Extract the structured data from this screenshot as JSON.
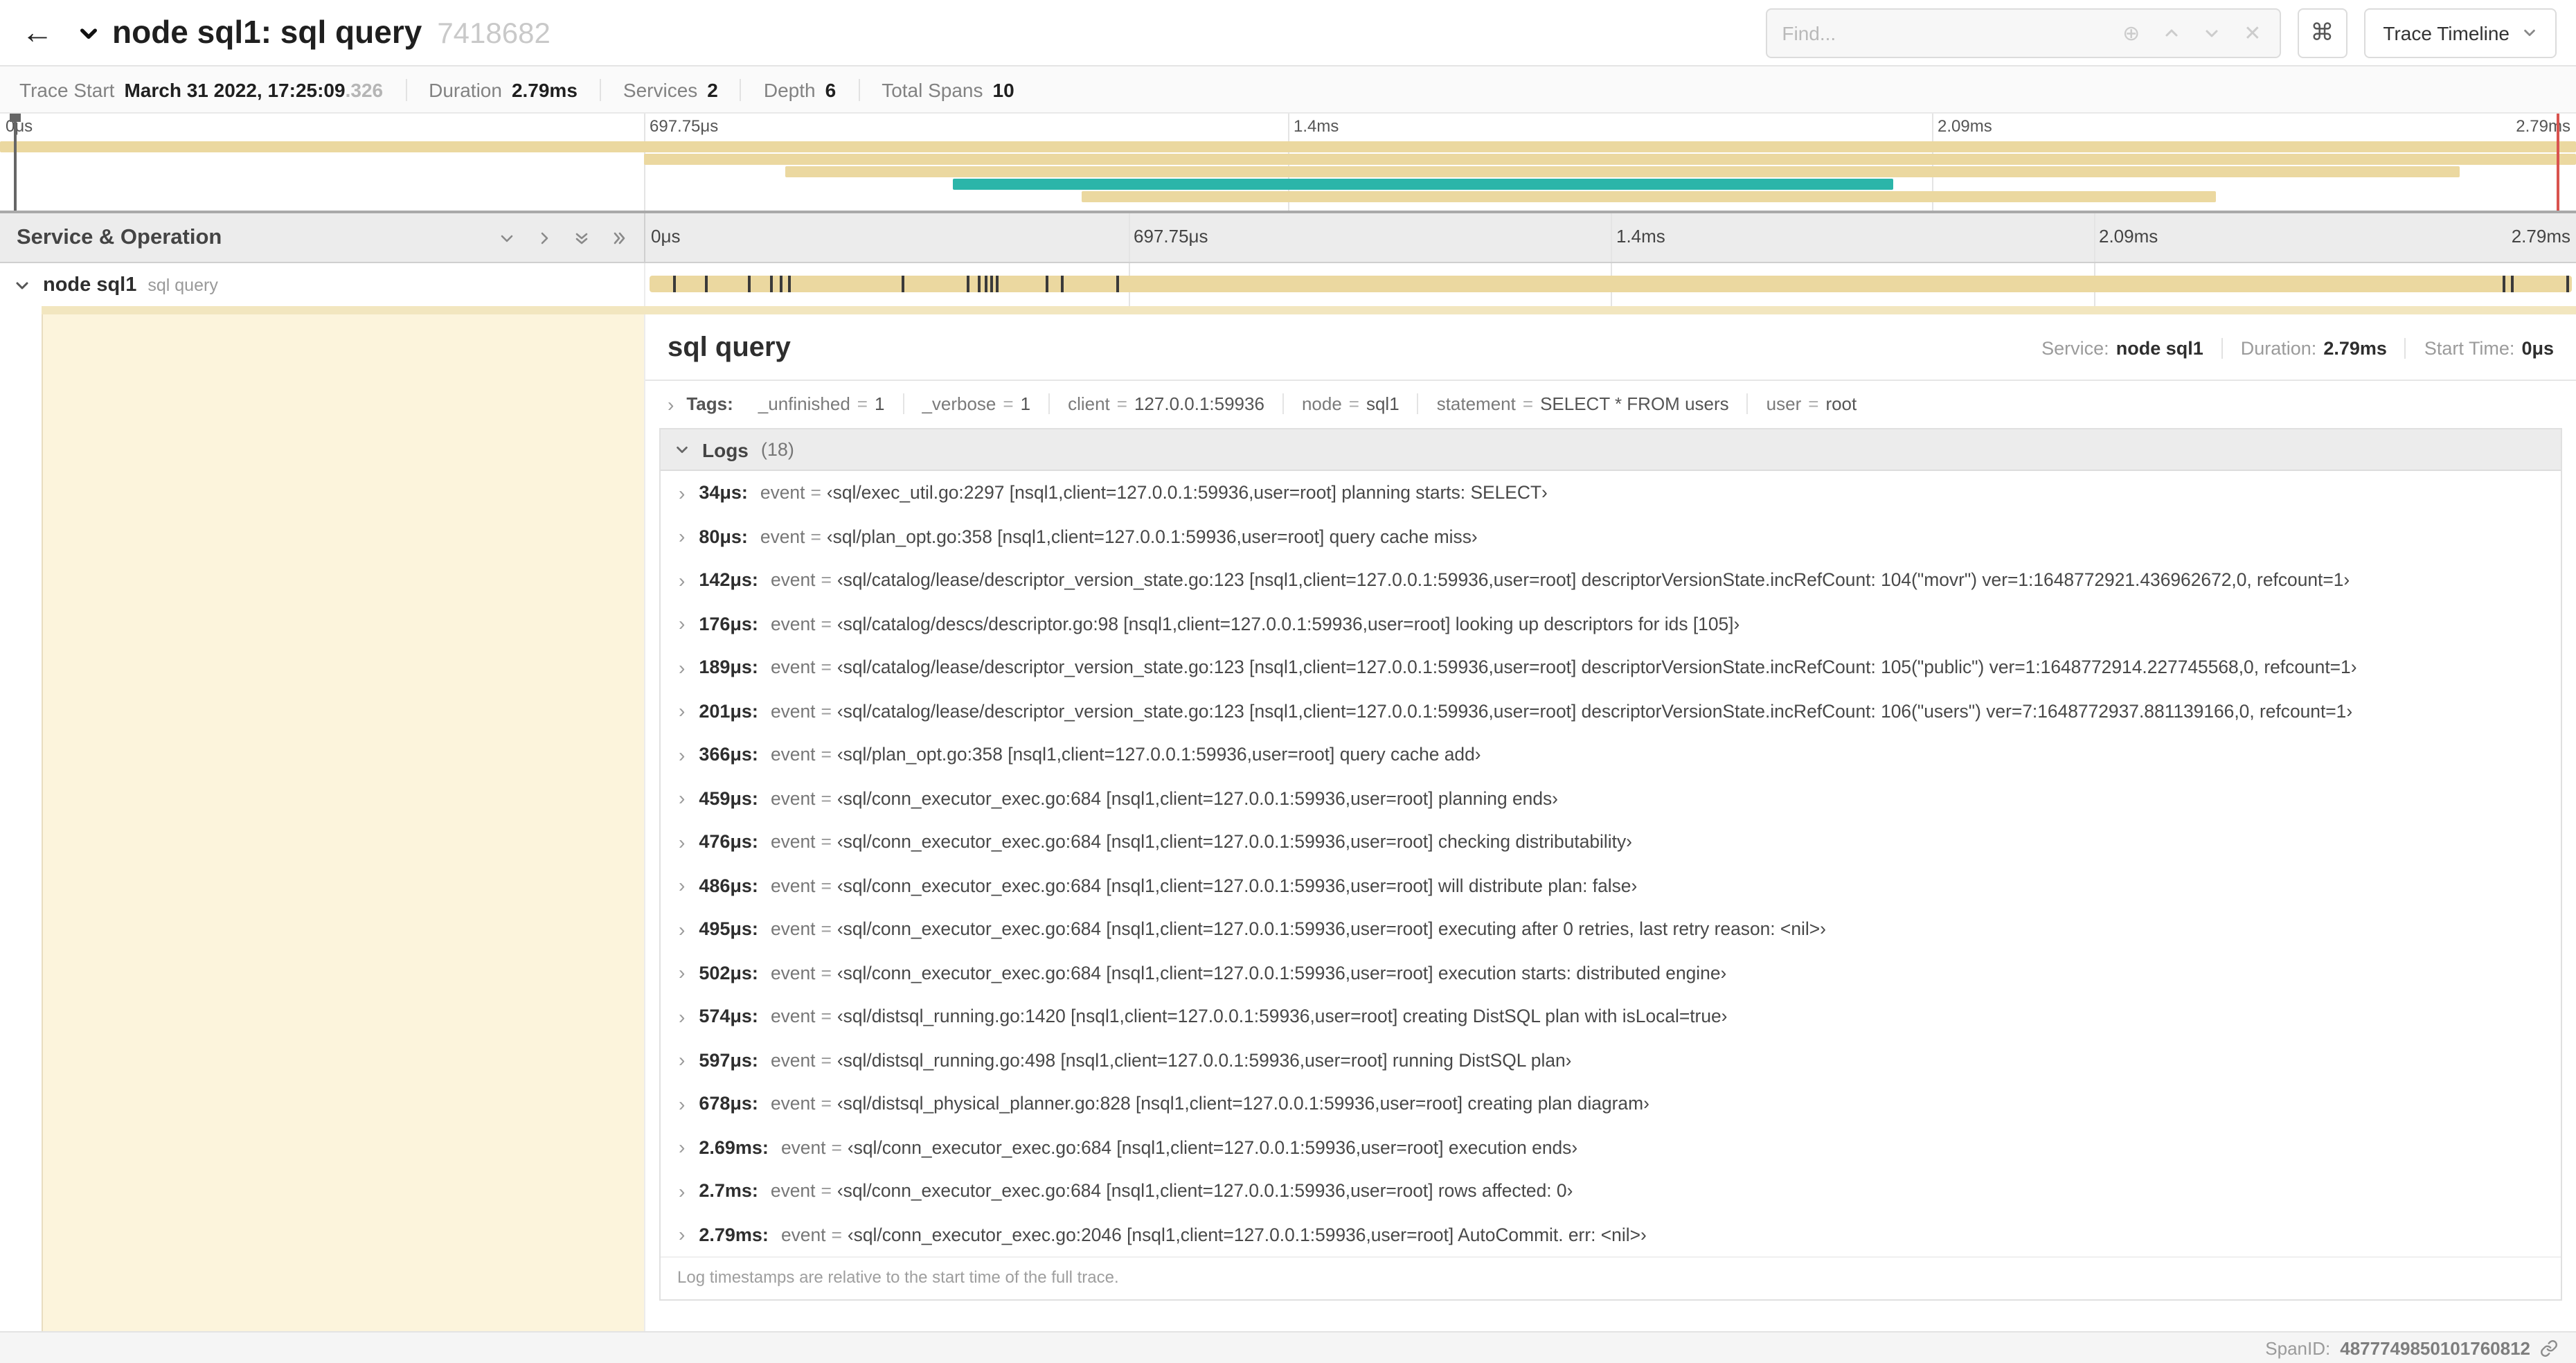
{
  "header": {
    "title": "node sql1: sql query",
    "trace_id": "7418682",
    "find_placeholder": "Find...",
    "kbd_label": "⌘",
    "view_label": "Trace Timeline"
  },
  "summary": {
    "items": [
      {
        "label": "Trace Start",
        "value": "March 31 2022, 17:25:09",
        "suffix": ".326"
      },
      {
        "label": "Duration",
        "value": "2.79ms"
      },
      {
        "label": "Services",
        "value": "2"
      },
      {
        "label": "Depth",
        "value": "6"
      },
      {
        "label": "Total Spans",
        "value": "10"
      }
    ]
  },
  "colors": {
    "tan": "#EBD8A0",
    "teal": "#2BB5A9",
    "cream": "#FCF4DC",
    "end_marker": "#D9534F"
  },
  "minimap": {
    "ticks": [
      "0μs",
      "697.75μs",
      "1.4ms",
      "2.09ms",
      "2.79ms"
    ],
    "bars": [
      {
        "row": 0,
        "start": 0,
        "end": 100,
        "color": "tan"
      },
      {
        "row": 1,
        "start": 25,
        "end": 100,
        "color": "tan"
      },
      {
        "row": 2,
        "start": 30.5,
        "end": 95.5,
        "color": "tan"
      },
      {
        "row": 3,
        "start": 37,
        "end": 73.5,
        "color": "teal"
      },
      {
        "row": 4,
        "start": 42,
        "end": 86,
        "color": "tan"
      }
    ]
  },
  "timeline": {
    "left_header": "Service & Operation",
    "ruler_ticks": [
      "0μs",
      "697.75μs",
      "1.4ms",
      "2.09ms",
      "2.79ms"
    ],
    "row": {
      "service": "node sql1",
      "operation": "sql query"
    },
    "tick_percents": [
      1.2,
      2.9,
      5.1,
      6.3,
      6.8,
      7.2,
      13.1,
      16.5,
      17.1,
      17.4,
      17.7,
      18,
      20.6,
      21.4,
      24.3,
      96.4,
      96.8,
      99.7
    ]
  },
  "detail": {
    "title": "sql query",
    "service_label": "Service:",
    "service_value": "node sql1",
    "duration_label": "Duration:",
    "duration_value": "2.79ms",
    "start_label": "Start Time:",
    "start_value": "0μs",
    "tags_label": "Tags:",
    "tags": [
      {
        "key": "_unfinished",
        "value": "1"
      },
      {
        "key": "_verbose",
        "value": "1"
      },
      {
        "key": "client",
        "value": "127.0.0.1:59936"
      },
      {
        "key": "node",
        "value": "sql1"
      },
      {
        "key": "statement",
        "value": "SELECT * FROM users"
      },
      {
        "key": "user",
        "value": "root"
      }
    ],
    "logs_label": "Logs",
    "logs_count": "(18)",
    "logs": [
      {
        "time": "34μs:",
        "key": "event",
        "text": "‹sql/exec_util.go:2297 [nsql1,client=127.0.0.1:59936,user=root] planning starts: SELECT›"
      },
      {
        "time": "80μs:",
        "key": "event",
        "text": "‹sql/plan_opt.go:358 [nsql1,client=127.0.0.1:59936,user=root] query cache miss›"
      },
      {
        "time": "142μs:",
        "key": "event",
        "text": "‹sql/catalog/lease/descriptor_version_state.go:123 [nsql1,client=127.0.0.1:59936,user=root] descriptorVersionState.incRefCount: 104(\"movr\") ver=1:1648772921.436962672,0, refcount=1›"
      },
      {
        "time": "176μs:",
        "key": "event",
        "text": "‹sql/catalog/descs/descriptor.go:98 [nsql1,client=127.0.0.1:59936,user=root] looking up descriptors for ids [105]›"
      },
      {
        "time": "189μs:",
        "key": "event",
        "text": "‹sql/catalog/lease/descriptor_version_state.go:123 [nsql1,client=127.0.0.1:59936,user=root] descriptorVersionState.incRefCount: 105(\"public\") ver=1:1648772914.227745568,0, refcount=1›"
      },
      {
        "time": "201μs:",
        "key": "event",
        "text": "‹sql/catalog/lease/descriptor_version_state.go:123 [nsql1,client=127.0.0.1:59936,user=root] descriptorVersionState.incRefCount: 106(\"users\") ver=7:1648772937.881139166,0, refcount=1›"
      },
      {
        "time": "366μs:",
        "key": "event",
        "text": "‹sql/plan_opt.go:358 [nsql1,client=127.0.0.1:59936,user=root] query cache add›"
      },
      {
        "time": "459μs:",
        "key": "event",
        "text": "‹sql/conn_executor_exec.go:684 [nsql1,client=127.0.0.1:59936,user=root] planning ends›"
      },
      {
        "time": "476μs:",
        "key": "event",
        "text": "‹sql/conn_executor_exec.go:684 [nsql1,client=127.0.0.1:59936,user=root] checking distributability›"
      },
      {
        "time": "486μs:",
        "key": "event",
        "text": "‹sql/conn_executor_exec.go:684 [nsql1,client=127.0.0.1:59936,user=root] will distribute plan: false›"
      },
      {
        "time": "495μs:",
        "key": "event",
        "text": "‹sql/conn_executor_exec.go:684 [nsql1,client=127.0.0.1:59936,user=root] executing after 0 retries, last retry reason: <nil>›"
      },
      {
        "time": "502μs:",
        "key": "event",
        "text": "‹sql/conn_executor_exec.go:684 [nsql1,client=127.0.0.1:59936,user=root] execution starts: distributed engine›"
      },
      {
        "time": "574μs:",
        "key": "event",
        "text": "‹sql/distsql_running.go:1420 [nsql1,client=127.0.0.1:59936,user=root] creating DistSQL plan with isLocal=true›"
      },
      {
        "time": "597μs:",
        "key": "event",
        "text": "‹sql/distsql_running.go:498 [nsql1,client=127.0.0.1:59936,user=root] running DistSQL plan›"
      },
      {
        "time": "678μs:",
        "key": "event",
        "text": "‹sql/distsql_physical_planner.go:828 [nsql1,client=127.0.0.1:59936,user=root] creating plan diagram›"
      },
      {
        "time": "2.69ms:",
        "key": "event",
        "text": "‹sql/conn_executor_exec.go:684 [nsql1,client=127.0.0.1:59936,user=root] execution ends›"
      },
      {
        "time": "2.7ms:",
        "key": "event",
        "text": "‹sql/conn_executor_exec.go:684 [nsql1,client=127.0.0.1:59936,user=root] rows affected: 0›"
      },
      {
        "time": "2.79ms:",
        "key": "event",
        "text": "‹sql/conn_executor_exec.go:2046 [nsql1,client=127.0.0.1:59936,user=root] AutoCommit. err: <nil>›"
      }
    ],
    "logs_note": "Log timestamps are relative to the start time of the full trace.",
    "spanid_label": "SpanID:",
    "spanid_value": "4877749850101760812"
  }
}
